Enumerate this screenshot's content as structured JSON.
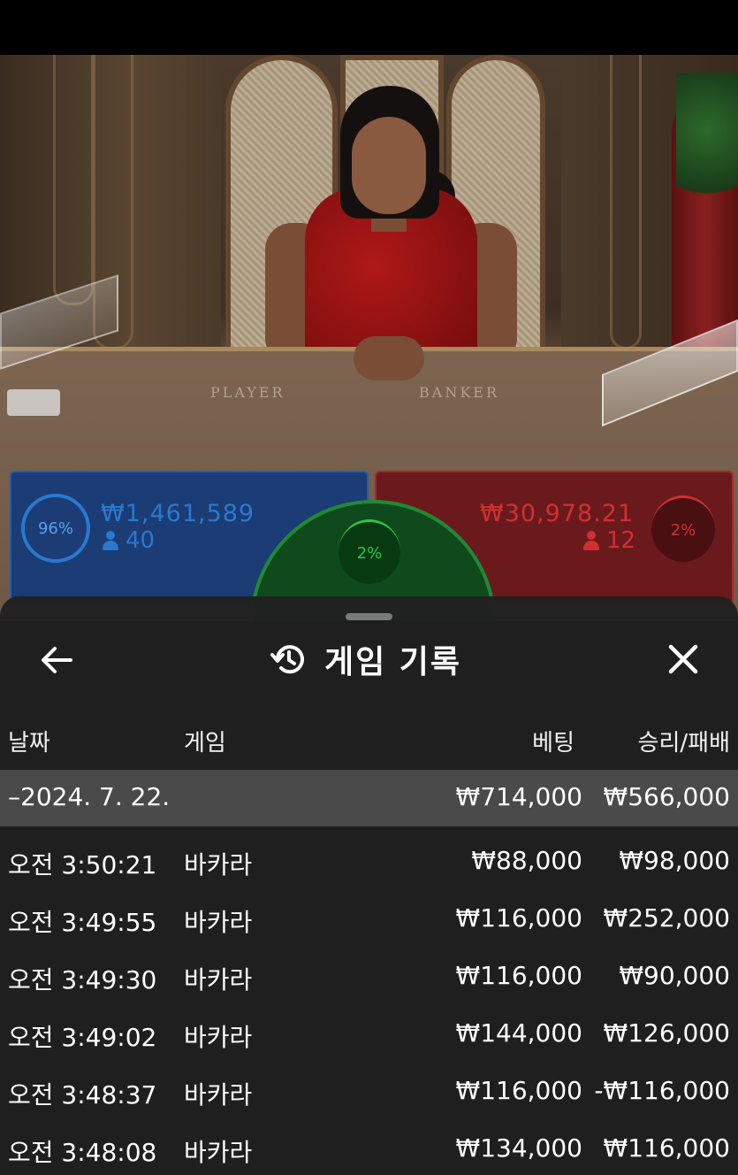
{
  "video": {
    "table_labels": {
      "player": "PLAYER",
      "banker": "BANKER"
    }
  },
  "betting": {
    "player": {
      "percent": "96%",
      "amount": "₩1,461,589",
      "players": "40",
      "color": "#58a0f0"
    },
    "tie": {
      "percent": "2%",
      "color": "#2ec44a"
    },
    "banker": {
      "percent": "2%",
      "amount": "₩30,978.21",
      "players": "12",
      "color": "#d03030"
    }
  },
  "history": {
    "title": "게임 기록",
    "icons": {
      "back": "arrow-left-icon",
      "title": "history-icon",
      "close": "close-icon"
    },
    "columns": {
      "date": "날짜",
      "game": "게임",
      "bet": "베팅",
      "result": "승리/패배"
    },
    "summary": {
      "date": "–2024. 7. 22.",
      "bet": "₩714,000",
      "result": "₩566,000"
    },
    "rows": [
      {
        "time": "오전 3:50:21",
        "game": "바카라",
        "bet": "₩88,000",
        "result": "₩98,000"
      },
      {
        "time": "오전 3:49:55",
        "game": "바카라",
        "bet": "₩116,000",
        "result": "₩252,000"
      },
      {
        "time": "오전 3:49:30",
        "game": "바카라",
        "bet": "₩116,000",
        "result": "₩90,000"
      },
      {
        "time": "오전 3:49:02",
        "game": "바카라",
        "bet": "₩144,000",
        "result": "₩126,000"
      },
      {
        "time": "오전 3:48:37",
        "game": "바카라",
        "bet": "₩116,000",
        "result": "-₩116,000"
      },
      {
        "time": "오전 3:48:08",
        "game": "바카라",
        "bet": "₩134,000",
        "result": "₩116,000"
      }
    ]
  }
}
